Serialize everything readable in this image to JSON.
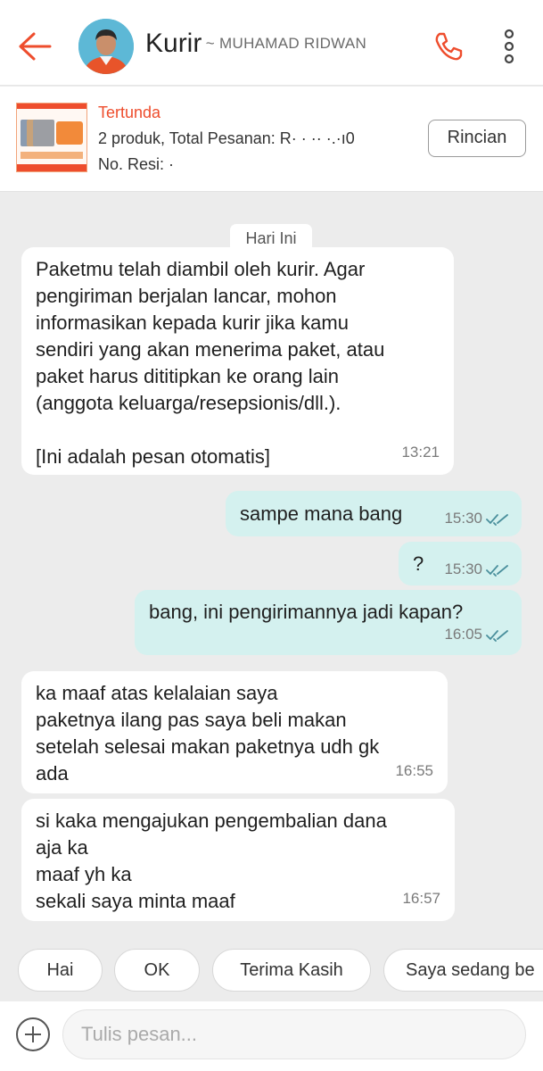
{
  "header": {
    "title": "Kurir",
    "subtitle": "~ MUHAMAD RIDWAN",
    "accent": "#ee4d2d"
  },
  "order": {
    "status": "Tertunda",
    "summary": "2 produk, Total Pesanan: R· · ·· ·.·ı0",
    "resi": "No. Resi: ·",
    "details_button": "Rincian"
  },
  "chat": {
    "date_separator": "Hari Ini",
    "messages": [
      {
        "dir": "in",
        "text": "Paketmu telah diambil oleh kurir. Agar\npengiriman berjalan lancar, mohon\ninformasikan kepada kurir jika kamu\nsendiri yang akan menerima paket, atau\npaket harus dititipkan ke orang lain\n(anggota keluarga/resepsionis/dll.).\n\n[Ini adalah pesan otomatis]",
        "time": "13:21"
      },
      {
        "dir": "out",
        "text": "sampe mana bang",
        "time": "15:30",
        "read": true
      },
      {
        "dir": "out",
        "text": "?",
        "time": "15:30",
        "read": true
      },
      {
        "dir": "out",
        "text": "bang, ini pengirimannya jadi kapan?",
        "time": "16:05",
        "read": true
      },
      {
        "dir": "in",
        "text": "ka maaf atas kelalaian saya\npaketnya ilang pas saya beli makan\nsetelah selesai makan paketnya udh gk\nada",
        "time": "16:55"
      },
      {
        "dir": "in",
        "text": "si kaka mengajukan pengembalian dana\naja ka\nmaaf yh ka\nsekali saya minta maaf",
        "time": "16:57"
      }
    ]
  },
  "quick_replies": [
    "Hai",
    "OK",
    "Terima Kasih",
    "Saya sedang be"
  ],
  "composer": {
    "placeholder": "Tulis pesan..."
  }
}
